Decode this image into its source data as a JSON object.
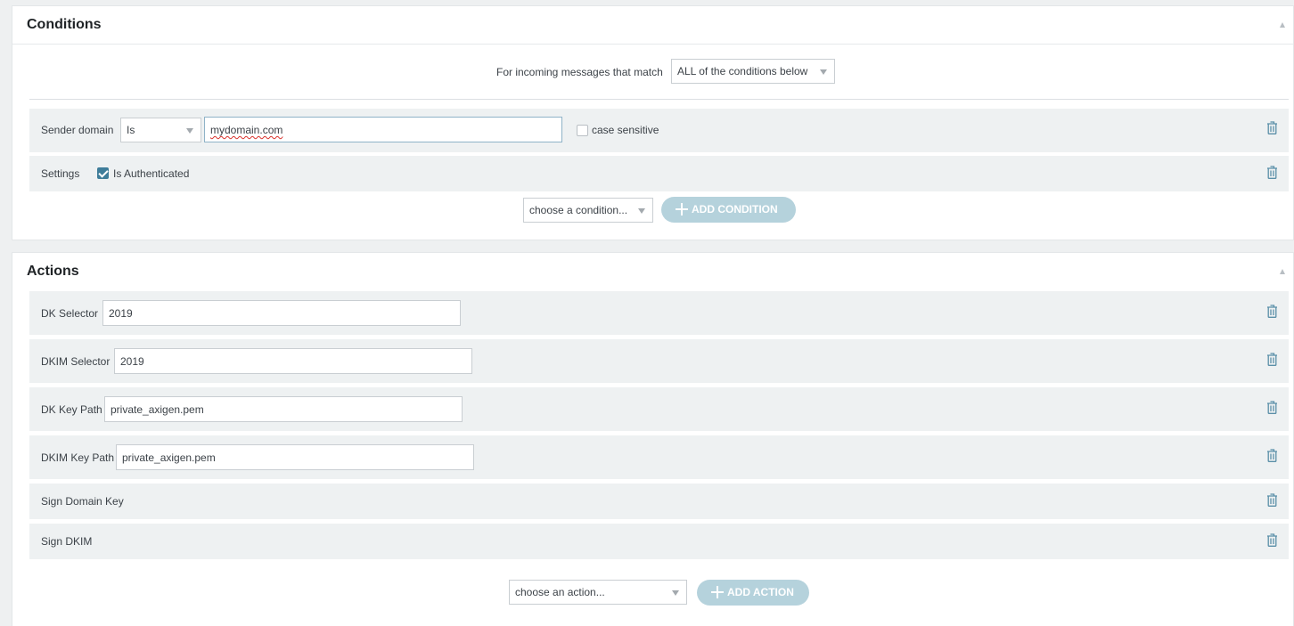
{
  "conditions": {
    "title": "Conditions",
    "match_label": "For incoming messages that match",
    "match_select": "ALL of the conditions below",
    "rows": [
      {
        "label": "Sender domain",
        "operator": "Is",
        "value": "mydomain.com",
        "case_sensitive_label": "case sensitive",
        "case_sensitive": false
      },
      {
        "label": "Settings",
        "checkbox_label": "Is Authenticated",
        "checked": true
      }
    ],
    "choose_placeholder": "choose a condition...",
    "add_label": "ADD CONDITION"
  },
  "actions": {
    "title": "Actions",
    "rows": [
      {
        "label": "DK Selector",
        "value": "2019"
      },
      {
        "label": "DKIM Selector",
        "value": "2019"
      },
      {
        "label": "DK Key Path",
        "value": "private_axigen.pem"
      },
      {
        "label": "DKIM Key Path",
        "value": "private_axigen.pem"
      },
      {
        "label": "Sign Domain Key"
      },
      {
        "label": "Sign DKIM"
      }
    ],
    "choose_placeholder": "choose an action...",
    "add_label": "ADD ACTION"
  },
  "colors": {
    "accent": "#3f7d9a",
    "add_button": "#b5d2dc",
    "row_background": "#eef1f2",
    "trash_icon": "#5a8fa8"
  },
  "icons": {
    "delete": "trash-icon",
    "collapse": "collapse-icon",
    "add": "plus-icon",
    "dropdown": "caret-down-icon"
  }
}
